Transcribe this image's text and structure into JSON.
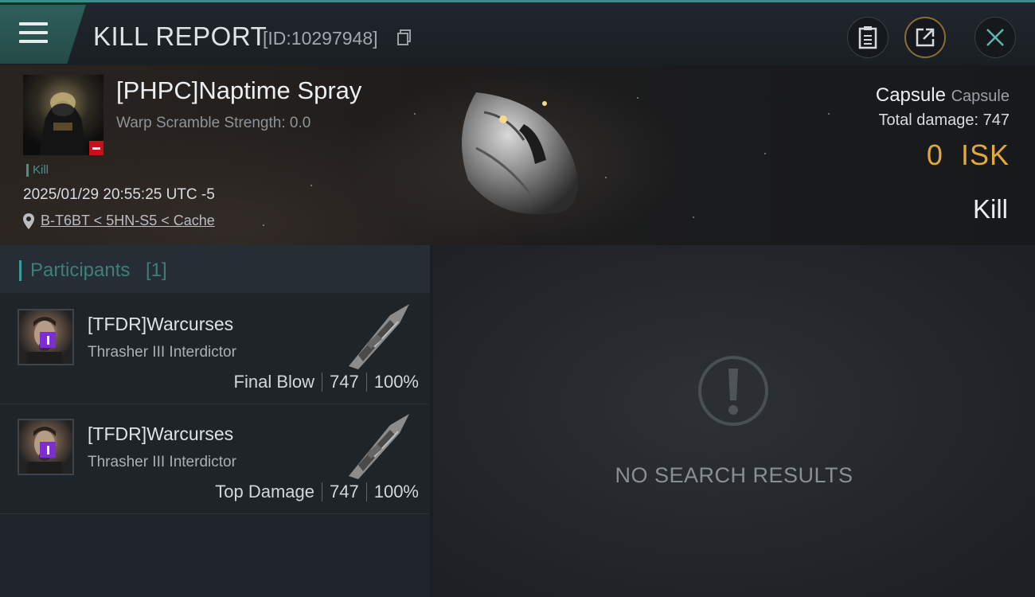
{
  "header": {
    "title": "KILL REPORT",
    "report_id": "[ID:10297948]"
  },
  "victim": {
    "name": "[PHPC]Naptime Spray",
    "warp_scramble": "Warp Scramble Strength: 0.0",
    "tag": "Kill",
    "date": "2025/01/29 20:55:25 UTC -5",
    "location": "B-T6BT < 5HN-S5 < Cache",
    "ship_name": "Capsule",
    "ship_type": "Capsule",
    "total_damage": "Total damage: 747",
    "isk_value": "0",
    "isk_unit": "ISK",
    "result": "Kill"
  },
  "participants": {
    "title": "Participants",
    "count": "[1]",
    "rows": [
      {
        "name": "[TFDR]Warcurses",
        "ship": "Thrasher III Interdictor",
        "role": "Final Blow",
        "damage": "747",
        "percent": "100%"
      },
      {
        "name": "[TFDR]Warcurses",
        "ship": "Thrasher III Interdictor",
        "role": "Top Damage",
        "damage": "747",
        "percent": "100%"
      }
    ]
  },
  "results": {
    "empty_text": "NO SEARCH RESULTS"
  },
  "colors": {
    "accent_teal": "#3a9c94",
    "isk_gold": "#e3a83a",
    "negative_badge": "#c3121b",
    "pilot_badge": "#7d2ed1"
  },
  "icons": {
    "menu": "hamburger-menu-icon",
    "copy": "copy-icon",
    "clipboard": "clipboard-icon",
    "share": "share-icon",
    "close": "close-icon",
    "location": "location-pin-icon",
    "alert": "exclamation-icon"
  }
}
